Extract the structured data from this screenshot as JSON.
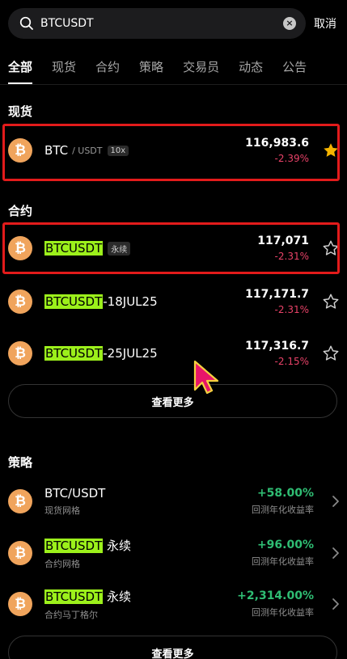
{
  "search": {
    "value": "BTCUSDT",
    "cancel_label": "取消"
  },
  "tabs": [
    "全部",
    "现货",
    "合约",
    "策略",
    "交易员",
    "动态",
    "公告"
  ],
  "spot": {
    "title": "现货",
    "row": {
      "coin_symbol": "₿",
      "name": "BTC",
      "quote": "/ USDT",
      "badge": "10x",
      "price": "116,983.6",
      "change": "-2.39%",
      "starred": true
    }
  },
  "futures": {
    "title": "合约",
    "rows": [
      {
        "coin_symbol": "₿",
        "highlight": "BTCUSDT",
        "suffix": "",
        "badge": "永续",
        "price": "117,071",
        "change": "-2.31%"
      },
      {
        "coin_symbol": "₿",
        "highlight": "BTCUSDT",
        "suffix": "-18JUL25",
        "badge": "",
        "price": "117,171.7",
        "change": "-2.31%"
      },
      {
        "coin_symbol": "₿",
        "highlight": "BTCUSDT",
        "suffix": "-25JUL25",
        "badge": "",
        "price": "117,316.7",
        "change": "-2.15%"
      }
    ],
    "more_label": "查看更多"
  },
  "strategy": {
    "title": "策略",
    "rows": [
      {
        "coin_symbol": "₿",
        "plain": "BTC/USDT",
        "highlight": "",
        "suffix": "",
        "sub": "现货网格",
        "value": "+58.00%",
        "value_label": "回测年化收益率"
      },
      {
        "coin_symbol": "₿",
        "plain": "",
        "highlight": "BTCUSDT",
        "suffix": " 永续",
        "sub": "合约网格",
        "value": "+96.00%",
        "value_label": "回测年化收益率"
      },
      {
        "coin_symbol": "₿",
        "plain": "",
        "highlight": "BTCUSDT",
        "suffix": " 永续",
        "sub": "合约马丁格尔",
        "value": "+2,314.00%",
        "value_label": "回测年化收益率"
      }
    ],
    "more_label": "查看更多"
  },
  "colors": {
    "accent_highlight": "#9cf01b",
    "negative": "#e84268",
    "positive": "#2fbd73",
    "star_filled": "#f5b400",
    "annotation_box": "#e31b1b"
  }
}
